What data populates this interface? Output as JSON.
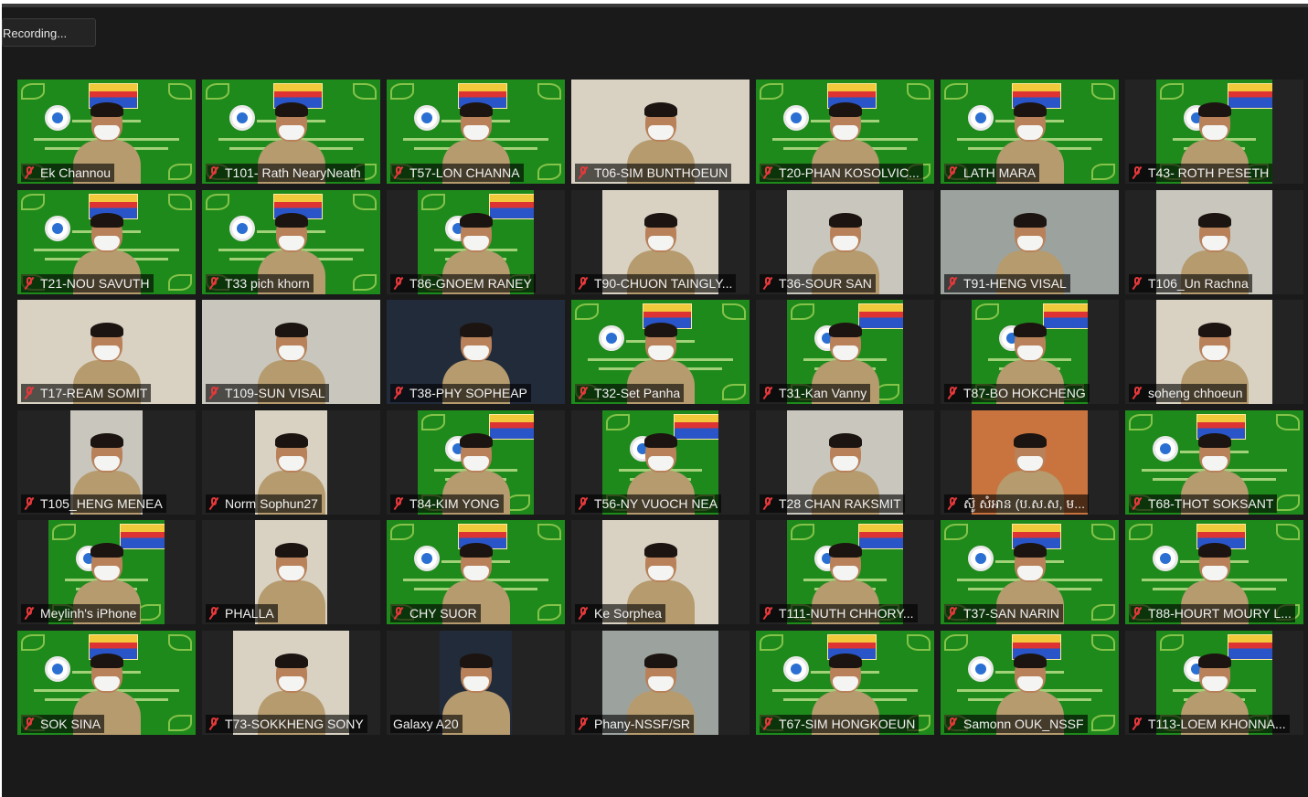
{
  "recording": {
    "label": "Recording..."
  },
  "colors": {
    "muted_icon": "#e5383b",
    "background": "#1a1a1a",
    "label_bg": "#000000"
  },
  "participants": [
    {
      "name": "Ek Channou",
      "muted": true,
      "bg": "green"
    },
    {
      "name": "T101- Rath NearyNeath",
      "muted": true,
      "bg": "green"
    },
    {
      "name": "T57-LON CHANNA",
      "muted": true,
      "bg": "green"
    },
    {
      "name": "T06-SIM BUNTHOEUN",
      "muted": true,
      "bg": "room"
    },
    {
      "name": "T20-PHAN KOSOLVIC...",
      "muted": true,
      "bg": "green"
    },
    {
      "name": "LATH MARA",
      "muted": true,
      "bg": "green"
    },
    {
      "name": "T43- ROTH PESETH",
      "muted": true,
      "bg": "green"
    },
    {
      "name": "T21-NOU SAVUTH",
      "muted": true,
      "bg": "green"
    },
    {
      "name": "T33 pich khorn",
      "muted": true,
      "bg": "green"
    },
    {
      "name": "T86-GNOEM RANEY",
      "muted": true,
      "bg": "green"
    },
    {
      "name": "T90-CHUON TAINGLY...",
      "muted": true,
      "bg": "room"
    },
    {
      "name": "T36-SOUR SAN",
      "muted": true,
      "bg": "wall"
    },
    {
      "name": "T91-HENG VISAL",
      "muted": true,
      "bg": "office"
    },
    {
      "name": "T106_Un Rachna",
      "muted": true,
      "bg": "wall"
    },
    {
      "name": "T17-REAM SOMIT",
      "muted": true,
      "bg": "room"
    },
    {
      "name": "T109-SUN VISAL",
      "muted": true,
      "bg": "wall"
    },
    {
      "name": "T38-PHY SOPHEAP",
      "muted": true,
      "bg": "dark"
    },
    {
      "name": "T32-Set Panha",
      "muted": true,
      "bg": "green"
    },
    {
      "name": "T31-Kan Vanny",
      "muted": true,
      "bg": "green"
    },
    {
      "name": "T87-BO HOKCHENG",
      "muted": true,
      "bg": "green"
    },
    {
      "name": "soheng chhoeun",
      "muted": true,
      "bg": "room"
    },
    {
      "name": "T105_HENG MENEA",
      "muted": true,
      "bg": "wall"
    },
    {
      "name": "Norm Sophun27",
      "muted": true,
      "bg": "room"
    },
    {
      "name": "T84-KIM YONG",
      "muted": true,
      "bg": "green"
    },
    {
      "name": "T56-NY VUOCH NEA",
      "muted": true,
      "bg": "green"
    },
    {
      "name": "T28 CHAN RAKSMIT",
      "muted": true,
      "bg": "wall"
    },
    {
      "name": "ស៊ូ សំអាន (ប.ស.ស, ម...",
      "muted": true,
      "bg": "warm"
    },
    {
      "name": "T68-THOT SOKSANT",
      "muted": true,
      "bg": "green"
    },
    {
      "name": "Meylinh's iPhone",
      "muted": true,
      "bg": "green"
    },
    {
      "name": "PHALLA",
      "muted": true,
      "bg": "room"
    },
    {
      "name": "CHY SUOR",
      "muted": true,
      "bg": "green"
    },
    {
      "name": "Ke Sorphea",
      "muted": true,
      "bg": "room"
    },
    {
      "name": "T111-NUTH CHHORY...",
      "muted": true,
      "bg": "green"
    },
    {
      "name": "T37-SAN NARIN",
      "muted": true,
      "bg": "green"
    },
    {
      "name": "T88-HOURT MOURY L...",
      "muted": true,
      "bg": "green"
    },
    {
      "name": "SOK SINA",
      "muted": true,
      "bg": "green"
    },
    {
      "name": "T73-SOKKHENG SONY",
      "muted": true,
      "bg": "room"
    },
    {
      "name": "Galaxy A20",
      "muted": false,
      "bg": "dark"
    },
    {
      "name": "Phany-NSSF/SR",
      "muted": true,
      "bg": "office"
    },
    {
      "name": "T67-SIM HONGKOEUN",
      "muted": true,
      "bg": "green"
    },
    {
      "name": "Samonn OUK_NSSF",
      "muted": true,
      "bg": "green"
    },
    {
      "name": "T113-LOEM KHONNA...",
      "muted": true,
      "bg": "green"
    }
  ]
}
